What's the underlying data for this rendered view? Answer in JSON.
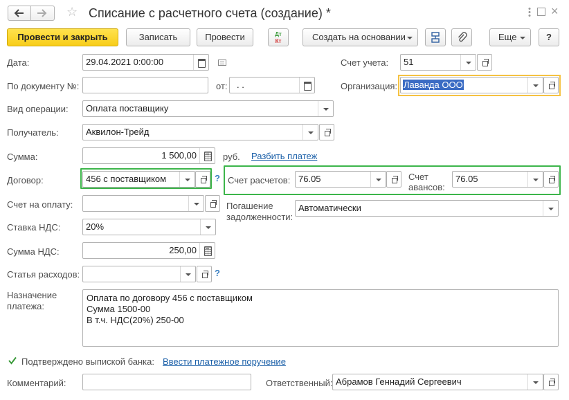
{
  "window": {
    "title": "Списание с расчетного счета (создание) *"
  },
  "toolbar": {
    "post_close": "Провести и закрыть",
    "save": "Записать",
    "post": "Провести",
    "dtkt_top": "Дт",
    "dtkt_bottom": "Кт",
    "create_based": "Создать на основании",
    "more": "Еще",
    "help": "?"
  },
  "form": {
    "date": {
      "label": "Дата:",
      "value": "29.04.2021  0:00:00"
    },
    "account": {
      "label": "Счет учета:",
      "value": "51"
    },
    "doc_number": {
      "label": "По документу №:",
      "value": ""
    },
    "doc_from": {
      "label": "от:",
      "value": " .  ."
    },
    "organization": {
      "label": "Организация:",
      "value": "Лаванда ООО"
    },
    "operation_type": {
      "label": "Вид операции:",
      "value": "Оплата поставщику"
    },
    "recipient": {
      "label": "Получатель:",
      "value": "Аквилон-Трейд"
    },
    "amount": {
      "label": "Сумма:",
      "value": "1 500,00",
      "currency": "руб.",
      "split_link": "Разбить платеж"
    },
    "contract": {
      "label": "Договор:",
      "value": "456 с поставщиком",
      "help": "?"
    },
    "settlement_account": {
      "label": "Счет расчетов:",
      "value": "76.05"
    },
    "advance_account": {
      "label_line1": "Счет",
      "label_line2": "авансов:",
      "value": "76.05"
    },
    "invoice": {
      "label": "Счет на оплату:",
      "value": ""
    },
    "debt_repayment": {
      "label_line1": "Погашение",
      "label_line2": "задолженности:",
      "value": "Автоматически"
    },
    "vat_rate": {
      "label": "Ставка НДС:",
      "value": "20%"
    },
    "vat_amount": {
      "label": "Сумма НДС:",
      "value": "250,00"
    },
    "expense_item": {
      "label": "Статья расходов:",
      "value": "",
      "help": "?"
    },
    "purpose": {
      "label_line1": "Назначение",
      "label_line2": "платежа:",
      "lines": [
        "Оплата по договору 456 с поставщиком",
        "Сумма 1500-00",
        "В т.ч. НДС(20%) 250-00"
      ]
    },
    "bank_confirmed": {
      "label": "Подтверждено выпиской банка:",
      "checked": true,
      "link": "Ввести платежное поручение"
    },
    "comment": {
      "label": "Комментарий:",
      "value": ""
    },
    "responsible": {
      "label": "Ответственный:",
      "value": "Абрамов Геннадий Сергеевич"
    }
  },
  "colors": {
    "primary_button": "#f8cd1a",
    "highlight_green": "#3cb54a",
    "highlight_yellow": "#f5c242",
    "link": "#1a5fa8",
    "selection": "#3b6cc4"
  }
}
